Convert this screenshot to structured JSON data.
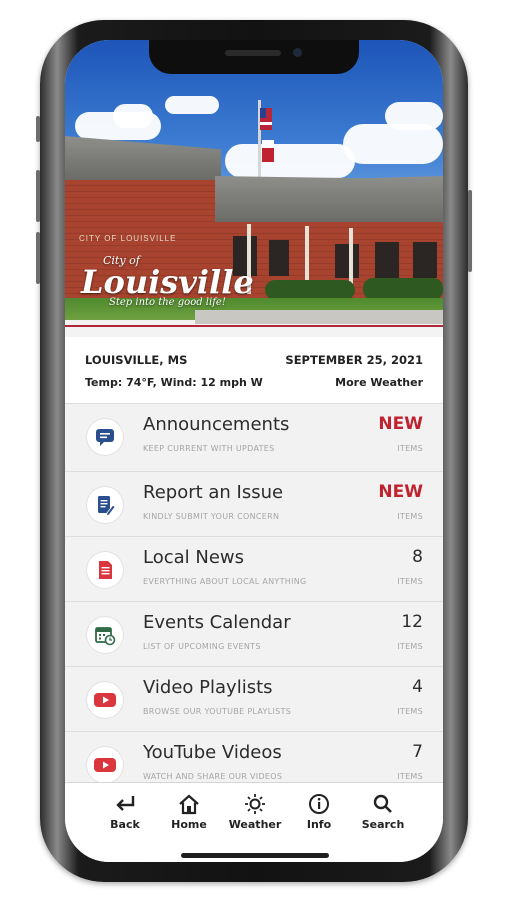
{
  "hero": {
    "sign_text": "CITY OF LOUISVILLE",
    "logo_city": "City of",
    "logo_name": "Louisville",
    "logo_tagline": "Step into the good life!"
  },
  "info": {
    "location": "LOUISVILLE, MS",
    "date": "SEPTEMBER 25, 2021",
    "weather": "Temp: 74°F, Wind: 12 mph W",
    "more_weather": "More Weather"
  },
  "colors": {
    "accent_red": "#c0232f",
    "icon_blue": "#2a4f8f",
    "icon_green": "#2f6b46",
    "youtube_red": "#d9363e"
  },
  "menu": [
    {
      "title": "Announcements",
      "subtitle": "KEEP CURRENT WITH UPDATES",
      "count": "NEW",
      "unit": "ITEMS",
      "icon": "chat-bubble-icon"
    },
    {
      "title": "Report an Issue",
      "subtitle": "KINDLY SUBMIT YOUR CONCERN",
      "count": "NEW",
      "unit": "ITEMS",
      "icon": "document-edit-icon"
    },
    {
      "title": "Local News",
      "subtitle": "EVERYTHING ABOUT LOCAL ANYTHING",
      "count": "8",
      "unit": "ITEMS",
      "icon": "news-document-icon"
    },
    {
      "title": "Events Calendar",
      "subtitle": "LIST OF UPCOMING EVENTS",
      "count": "12",
      "unit": "ITEMS",
      "icon": "calendar-clock-icon"
    },
    {
      "title": "Video Playlists",
      "subtitle": "BROWSE OUR YOUTUBE PLAYLISTS",
      "count": "4",
      "unit": "ITEMS",
      "icon": "youtube-icon"
    },
    {
      "title": "YouTube Videos",
      "subtitle": "WATCH AND SHARE OUR VIDEOS",
      "count": "7",
      "unit": "ITEMS",
      "icon": "youtube-icon"
    }
  ],
  "tabs": [
    {
      "label": "Back",
      "icon": "back-arrow-icon"
    },
    {
      "label": "Home",
      "icon": "home-icon"
    },
    {
      "label": "Weather",
      "icon": "sun-icon"
    },
    {
      "label": "Info",
      "icon": "info-icon"
    },
    {
      "label": "Search",
      "icon": "search-icon"
    }
  ]
}
